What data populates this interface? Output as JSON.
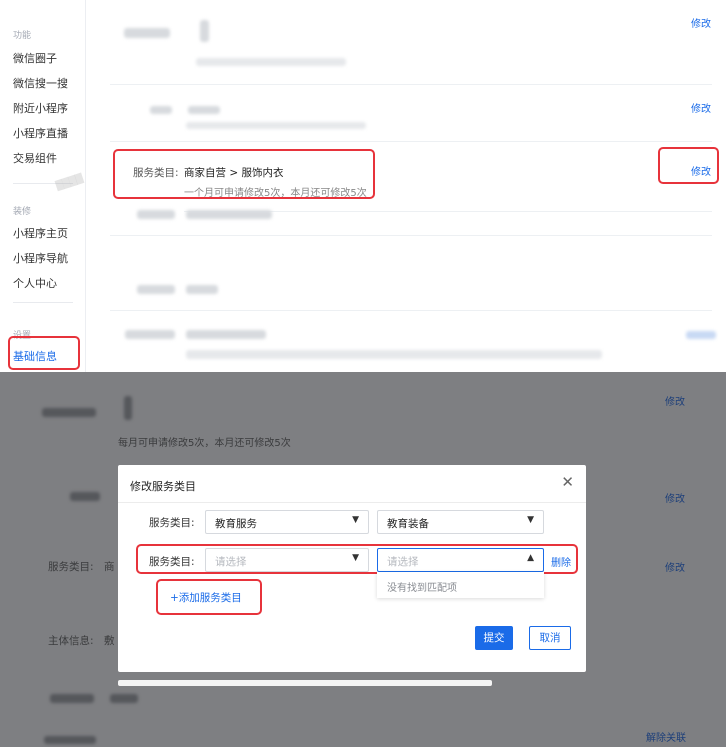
{
  "sidebar": {
    "group_features": "功能",
    "items_features": [
      "微信圈子",
      "微信搜一搜",
      "附近小程序",
      "小程序直播",
      "交易组件"
    ],
    "group_decor": "装修",
    "items_decor": [
      "小程序主页",
      "小程序导航",
      "个人中心"
    ],
    "group_settings": "设置",
    "active_item": "基础信息"
  },
  "settings_rows": {
    "edit_label": "修改",
    "service_category": {
      "label": "服务类目:",
      "value": "商家自营 > 服饰内衣",
      "note": "一个月可申请修改5次，本月还可修改5次"
    }
  },
  "background_rows": {
    "edit_label": "修改",
    "service_category_label": "服务类目:",
    "service_category_value_prefix": "商",
    "subject_label": "主体信息:",
    "subject_value_prefix": "敷",
    "unlink_label": "解除关联",
    "hint_partial": "每月可申请修改5次，本月还可修改5次"
  },
  "modal": {
    "title": "修改服务类目",
    "close_icon": "close-icon",
    "row1": {
      "label": "服务类目:",
      "primary": "教育服务",
      "secondary": "教育装备"
    },
    "row2": {
      "label": "服务类目:",
      "primary_placeholder": "请选择",
      "secondary_placeholder": "请选择",
      "delete_label": "删除"
    },
    "dropdown_empty": "没有找到匹配项",
    "add_label": "+添加服务类目",
    "submit_label": "提交",
    "cancel_label": "取消"
  },
  "colors": {
    "accent": "#1a6be8",
    "highlight_box": "#e7333b",
    "overlay": "#7e7f82"
  }
}
